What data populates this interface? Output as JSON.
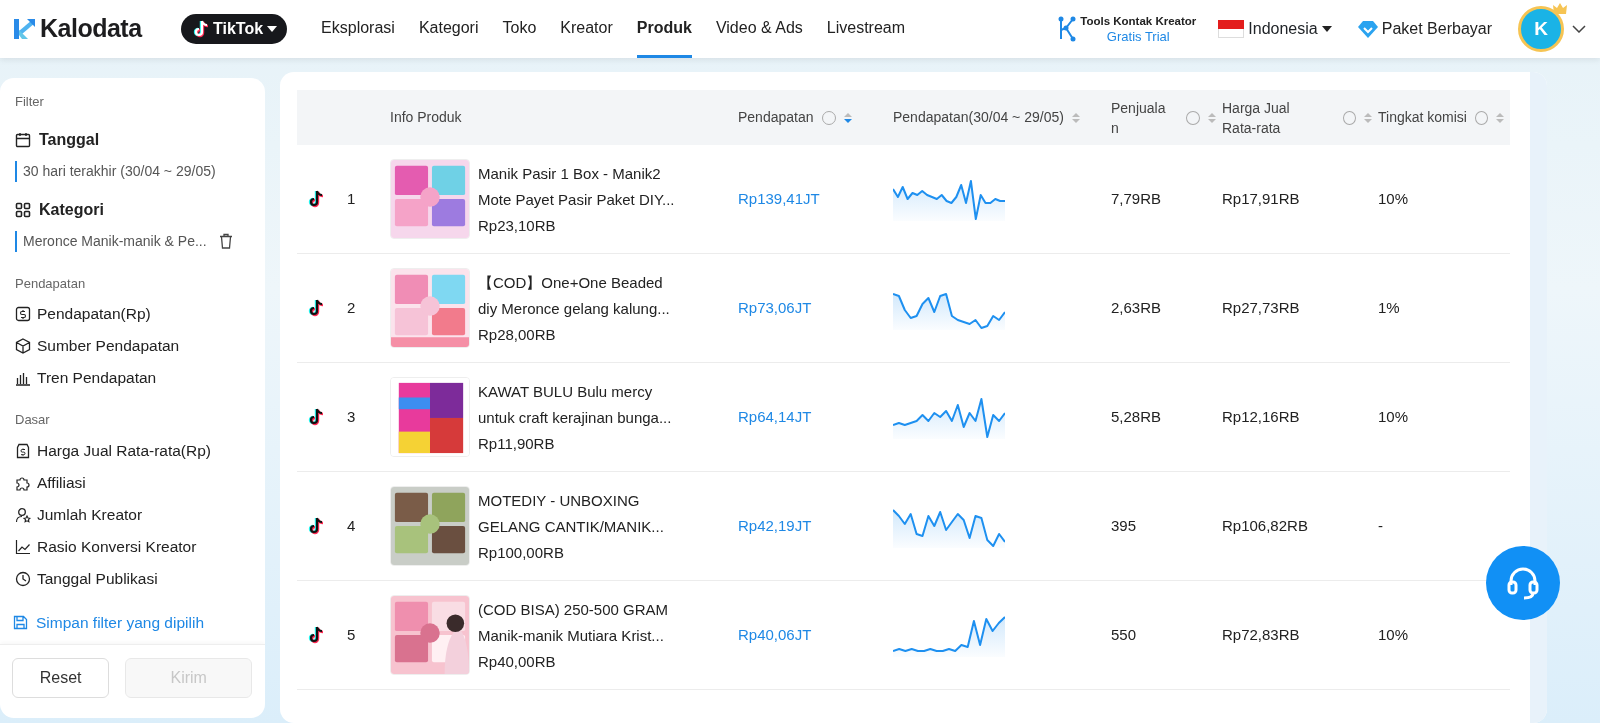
{
  "navbar": {
    "logo": "Kalodata",
    "platform": "TikTok",
    "links": [
      {
        "label": "Eksplorasi",
        "selected": false
      },
      {
        "label": "Kategori",
        "selected": false
      },
      {
        "label": "Toko",
        "selected": false
      },
      {
        "label": "Kreator",
        "selected": false
      },
      {
        "label": "Produk",
        "selected": true
      },
      {
        "label": "Video & Ads",
        "selected": false
      },
      {
        "label": "Livestream",
        "selected": false
      }
    ],
    "tools": {
      "title": "Tools Kontak Kreator",
      "subtitle": "Gratis Trial"
    },
    "country": "Indonesia",
    "plan": "Paket Berbayar",
    "avatar": "K"
  },
  "sidebar": {
    "title": "Filter",
    "filters": [
      {
        "kind": "date",
        "label": "Tanggal",
        "value": "30 hari terakhir (30/04 ~ 29/05)"
      },
      {
        "kind": "category",
        "label": "Kategori",
        "value": "Meronce Manik-manik & Pe..."
      }
    ],
    "sections": [
      {
        "title": "Pendapatan",
        "items": [
          {
            "label": "Pendapatan(Rp)"
          },
          {
            "label": "Sumber Pendapatan"
          },
          {
            "label": "Tren Pendapatan"
          }
        ]
      },
      {
        "title": "Dasar",
        "items": [
          {
            "label": "Harga Jual Rata-rata(Rp)"
          },
          {
            "label": "Affiliasi"
          },
          {
            "label": "Jumlah Kreator"
          },
          {
            "label": "Rasio Konversi Kreator"
          },
          {
            "label": "Tanggal Publikasi"
          }
        ]
      }
    ],
    "save_link": "Simpan filter yang dipilih",
    "buttons": [
      {
        "label": "Reset",
        "disabled": false
      },
      {
        "label": "Kirim",
        "disabled": true
      }
    ]
  },
  "table": {
    "columns": [
      {
        "kind": "plain",
        "label": "Info Produk"
      },
      {
        "kind": "sortable",
        "label": "Pendapatan",
        "help": true,
        "sorted": true
      },
      {
        "kind": "sortable",
        "label": "Pendapatan(30/04 ~ 29/05)",
        "help": false,
        "sorted": false
      },
      {
        "kind": "sortable",
        "label": "Penjualan",
        "help": true,
        "sorted": false
      },
      {
        "kind": "sortable",
        "label": "Harga Jual Rata-rata",
        "help": true,
        "sorted": false
      },
      {
        "kind": "sortable",
        "label": "Tingkat komisi",
        "help": true,
        "sorted": false
      }
    ],
    "rows": [
      {
        "rank": "1",
        "title_lines": [
          "Manik Pasir 1 Box - Manik2",
          "Mote Payet Pasir Paket DIY..."
        ],
        "price": "Rp23,10RB",
        "revenue": "Rp139,41JT",
        "sales": "7,79RB",
        "avg_price": "Rp17,91RB",
        "commission": "10%"
      },
      {
        "rank": "2",
        "title_lines": [
          "【COD】One+One Beaded",
          "diy Meronce gelang kalung..."
        ],
        "price": "Rp28,00RB",
        "revenue": "Rp73,06JT",
        "sales": "2,63RB",
        "avg_price": "Rp27,73RB",
        "commission": "1%"
      },
      {
        "rank": "3",
        "title_lines": [
          "KAWAT BULU Bulu mercy",
          "untuk craft kerajinan bunga..."
        ],
        "price": "Rp11,90RB",
        "revenue": "Rp64,14JT",
        "sales": "5,28RB",
        "avg_price": "Rp12,16RB",
        "commission": "10%"
      },
      {
        "rank": "4",
        "title_lines": [
          "MOTEDIY - UNBOXING",
          "GELANG CANTIK/MANIK..."
        ],
        "price": "Rp100,00RB",
        "revenue": "Rp42,19JT",
        "sales": "395",
        "avg_price": "Rp106,82RB",
        "commission": "-"
      },
      {
        "rank": "5",
        "title_lines": [
          "(COD BISA) 250-500 GRAM",
          "Manik-manik Mutiara Krist..."
        ],
        "price": "Rp40,00RB",
        "revenue": "Rp40,06JT",
        "sales": "550",
        "avg_price": "Rp72,83RB",
        "commission": "10%"
      }
    ]
  }
}
